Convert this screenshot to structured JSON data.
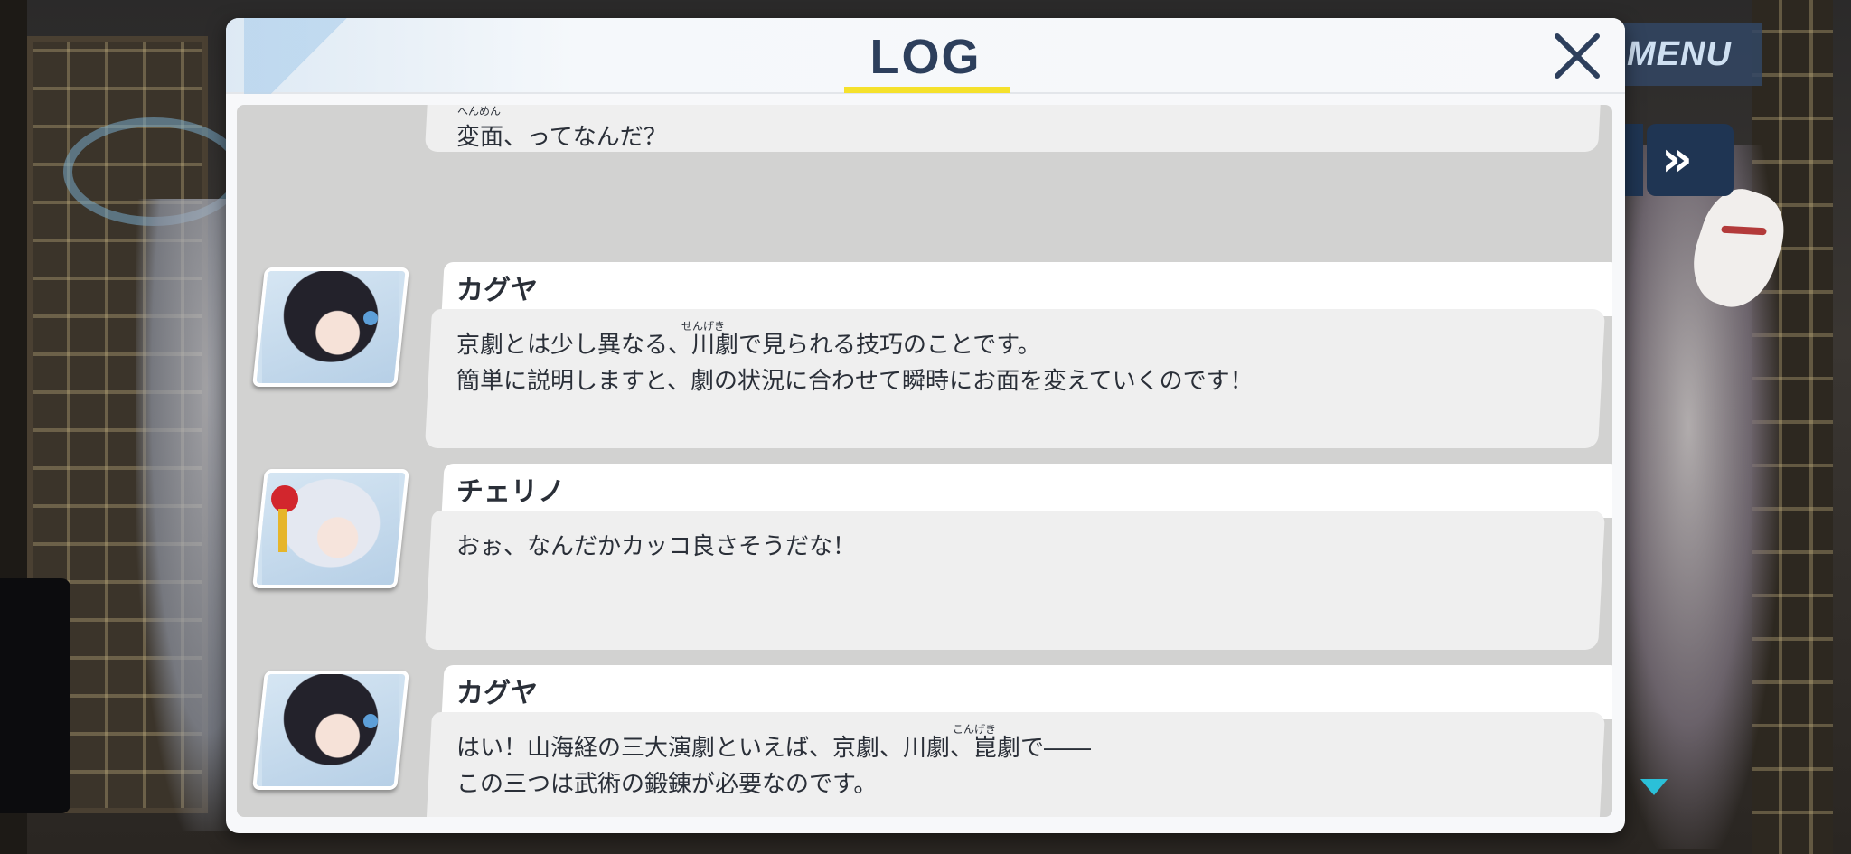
{
  "hud": {
    "menu_label": "MENU",
    "fast_forward_glyph": "»"
  },
  "log": {
    "title": "LOG",
    "close_glyph": "close-icon",
    "entries": [
      {
        "speaker": "",
        "portrait": "cherino-portrait",
        "ruby": "へんめん",
        "lines": "変面、ってなんだ？"
      },
      {
        "speaker": "カグヤ",
        "portrait": "kaguya-portrait",
        "ruby": "せんげき",
        "lines": "京劇とは少し異なる、川劇で見られる技巧のことです。\n簡単に説明しますと、劇の状況に合わせて瞬時にお面を変えていくのです！"
      },
      {
        "speaker": "チェリノ",
        "portrait": "cherino-portrait",
        "ruby": "",
        "lines": "おぉ、なんだかカッコ良さそうだな！"
      },
      {
        "speaker": "カグヤ",
        "portrait": "kaguya-portrait",
        "ruby": "こんげき",
        "lines": "はい！山海経の三大演劇といえば、京劇、川劇、崑劇で――\nこの三つは武術の鍛錬が必要なのです。"
      }
    ]
  },
  "colors": {
    "title": "#2d3f5c",
    "underline": "#f5e12c",
    "hud_button": "#1f3553",
    "scroll_arrow": "#2bc0d8"
  }
}
